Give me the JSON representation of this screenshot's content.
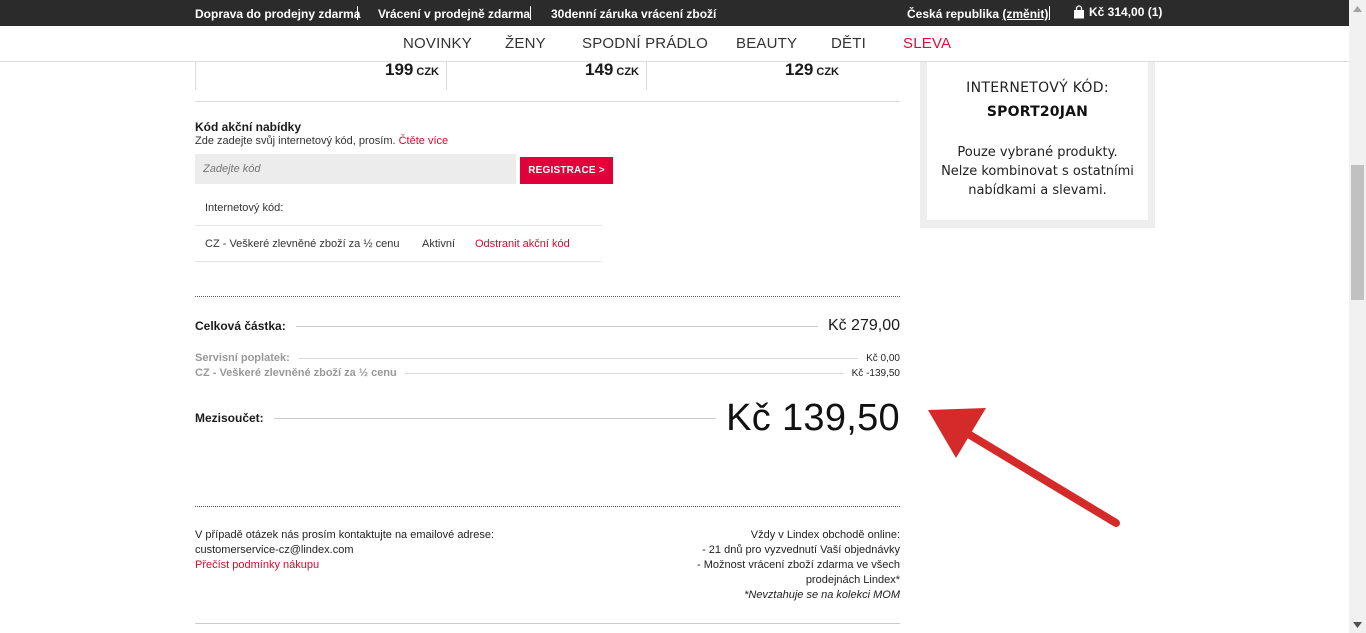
{
  "topbar": {
    "promo1": "Doprava do prodejny zdarma",
    "promo2": "Vrácení v prodejně zdarma",
    "promo3": "30denní záruka vrácení zboží",
    "country": "Česká republika",
    "change_link": "(změnit)",
    "cart_icon": "bag-icon",
    "cart_summary": "Kč 314,00 (1)"
  },
  "nav": {
    "items": [
      "NOVINKY",
      "ŽENY",
      "SPODNÍ PRÁDLO",
      "BEAUTY",
      "DĚTI",
      "SLEVA"
    ],
    "sale_color": "#d5113a"
  },
  "prices": [
    {
      "value": "199",
      "currency": "CZK"
    },
    {
      "value": "149",
      "currency": "CZK"
    },
    {
      "value": "129",
      "currency": "CZK"
    }
  ],
  "promo": {
    "title": "Kód akční nabídky",
    "subtitle": "Zde zadejte svůj internetový kód, prosím.",
    "read_more": "Čtěte více",
    "placeholder": "Zadejte kód",
    "register_button": "REGISTRACE >",
    "internet_code_label": "Internetový kód:",
    "applied_code": "CZ - Veškeré zlevněné zboží za ½ cenu",
    "applied_status": "Aktivní",
    "remove_link": "Odstranit akční kód"
  },
  "summary": {
    "total_label": "Celková částka:",
    "total_value": "Kč 279,00",
    "fee_label": "Servisní poplatek:",
    "fee_value": "Kč 0,00",
    "discount_label": "CZ - Veškeré zlevněné zboží za ½ cenu",
    "discount_value": "Kč -139,50",
    "subtotal_label": "Mezisoučet:",
    "subtotal_value": "Kč 139,50"
  },
  "contact": {
    "line1": "V případě otázek nás prosím kontaktujte na emailové adrese:",
    "email": "customerservice-cz@lindex.com",
    "terms_link": "Přečíst podmínky nákupu",
    "right_line1": "Vždy v Lindex obchodě online:",
    "right_line2": "- 21 dnů pro vyzvednutí Vaší objednávky",
    "right_line3": "- Možnost vrácení zboží zdarma ve všech",
    "right_line4": "prodejnách Lindex*",
    "right_note": "*Nevztahuje se na kolekci MOM"
  },
  "side_box": {
    "label": "INTERNETOVÝ KÓD:",
    "code": "SPORT20JAN",
    "desc1": "Pouze vybrané produkty.",
    "desc2": "Nelze kombinovat s ostatními",
    "desc3": "nabídkami a slevami."
  },
  "colors": {
    "accent": "#e2003a",
    "link": "#c8102e",
    "topbar": "#2b2b2b",
    "annotation_arrow": "#d42a2a"
  }
}
